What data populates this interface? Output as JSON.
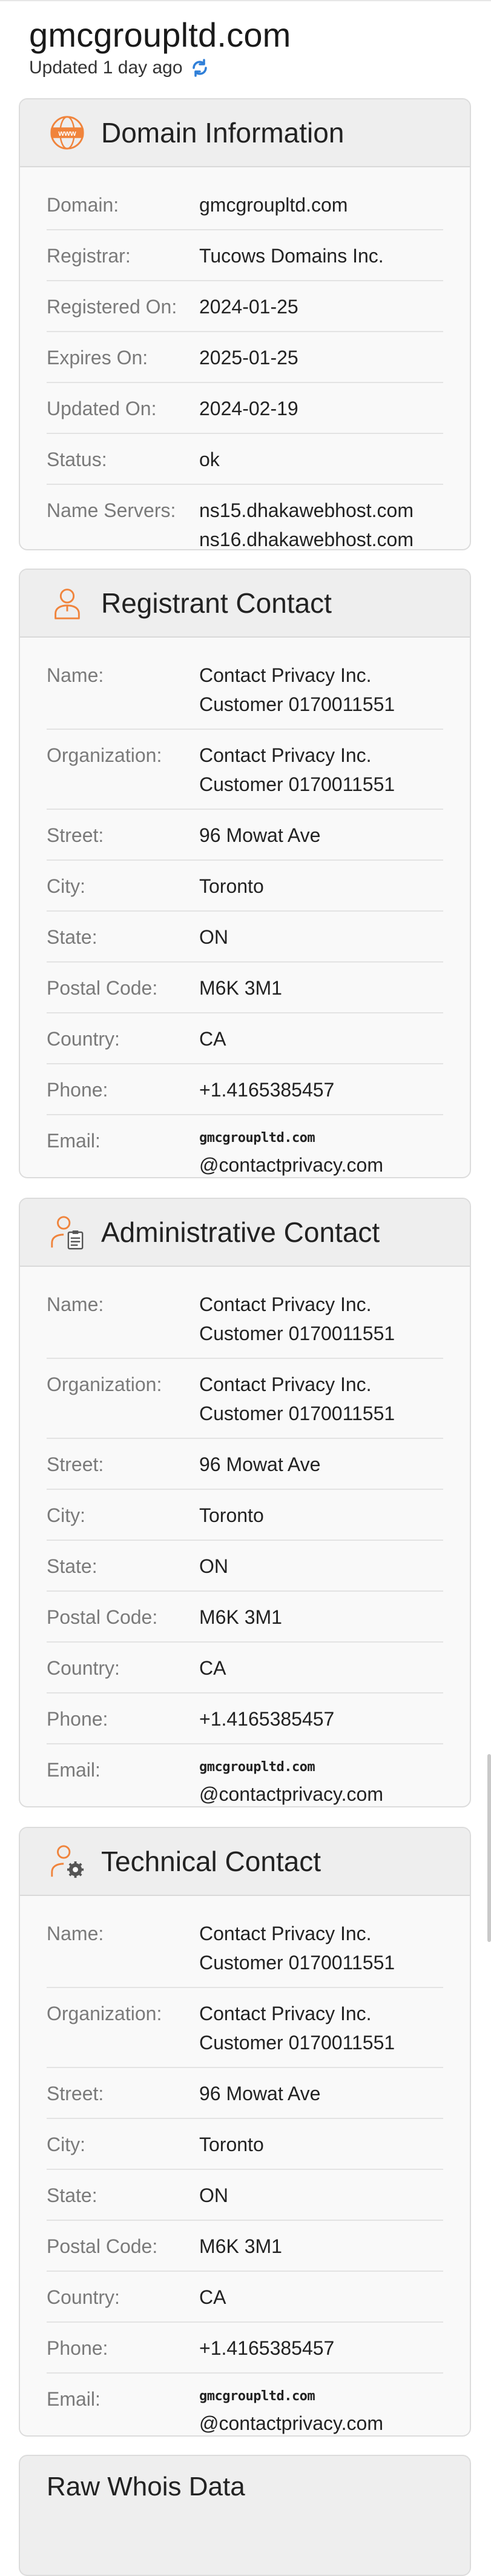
{
  "site": {
    "domain_title": "gmcgroupltd.com",
    "updated": "Updated 1 day ago"
  },
  "domain_info": {
    "title": "Domain Information",
    "rows": [
      {
        "label": "Domain:",
        "value": [
          "gmcgroupltd.com"
        ]
      },
      {
        "label": "Registrar:",
        "value": [
          "Tucows Domains Inc."
        ]
      },
      {
        "label": "Registered On:",
        "value": [
          "2024-01-25"
        ]
      },
      {
        "label": "Expires On:",
        "value": [
          "2025-01-25"
        ]
      },
      {
        "label": "Updated On:",
        "value": [
          "2024-02-19"
        ]
      },
      {
        "label": "Status:",
        "value": [
          "ok"
        ]
      },
      {
        "label": "Name Servers:",
        "value": [
          "ns15.dhakawebhost.com",
          "ns16.dhakawebhost.com"
        ]
      }
    ]
  },
  "registrant": {
    "title": "Registrant Contact",
    "rows": [
      {
        "label": "Name:",
        "value": [
          "Contact Privacy Inc.",
          "Customer 0170011551"
        ]
      },
      {
        "label": "Organization:",
        "value": [
          "Contact Privacy Inc.",
          "Customer 0170011551"
        ]
      },
      {
        "label": "Street:",
        "value": [
          "96 Mowat Ave"
        ]
      },
      {
        "label": "City:",
        "value": [
          "Toronto"
        ]
      },
      {
        "label": "State:",
        "value": [
          "ON"
        ]
      },
      {
        "label": "Postal Code:",
        "value": [
          "M6K 3M1"
        ]
      },
      {
        "label": "Country:",
        "value": [
          "CA"
        ]
      },
      {
        "label": "Phone:",
        "value": [
          "+1.4165385457"
        ]
      },
      {
        "label": "Email:",
        "email_user": "gmcgroupltd.com",
        "email_domain": "@contactprivacy.com"
      }
    ]
  },
  "administrative": {
    "title": "Administrative Contact",
    "rows": [
      {
        "label": "Name:",
        "value": [
          "Contact Privacy Inc.",
          "Customer 0170011551"
        ]
      },
      {
        "label": "Organization:",
        "value": [
          "Contact Privacy Inc.",
          "Customer 0170011551"
        ]
      },
      {
        "label": "Street:",
        "value": [
          "96 Mowat Ave"
        ]
      },
      {
        "label": "City:",
        "value": [
          "Toronto"
        ]
      },
      {
        "label": "State:",
        "value": [
          "ON"
        ]
      },
      {
        "label": "Postal Code:",
        "value": [
          "M6K 3M1"
        ]
      },
      {
        "label": "Country:",
        "value": [
          "CA"
        ]
      },
      {
        "label": "Phone:",
        "value": [
          "+1.4165385457"
        ]
      },
      {
        "label": "Email:",
        "email_user": "gmcgroupltd.com",
        "email_domain": "@contactprivacy.com"
      }
    ]
  },
  "technical": {
    "title": "Technical Contact",
    "rows": [
      {
        "label": "Name:",
        "value": [
          "Contact Privacy Inc.",
          "Customer 0170011551"
        ]
      },
      {
        "label": "Organization:",
        "value": [
          "Contact Privacy Inc.",
          "Customer 0170011551"
        ]
      },
      {
        "label": "Street:",
        "value": [
          "96 Mowat Ave"
        ]
      },
      {
        "label": "City:",
        "value": [
          "Toronto"
        ]
      },
      {
        "label": "State:",
        "value": [
          "ON"
        ]
      },
      {
        "label": "Postal Code:",
        "value": [
          "M6K 3M1"
        ]
      },
      {
        "label": "Country:",
        "value": [
          "CA"
        ]
      },
      {
        "label": "Phone:",
        "value": [
          "+1.4165385457"
        ]
      },
      {
        "label": "Email:",
        "email_user": "gmcgroupltd.com",
        "email_domain": "@contactprivacy.com"
      }
    ]
  },
  "raw": {
    "title": "Raw Whois Data"
  },
  "icons": {
    "domain": "www-globe-icon",
    "registrant": "person-icon",
    "administrative": "person-clipboard-icon",
    "technical": "person-gear-icon",
    "refresh": "refresh-icon"
  },
  "colors": {
    "accent_orange": "#f0843c",
    "refresh_blue": "#2f7fd8"
  }
}
